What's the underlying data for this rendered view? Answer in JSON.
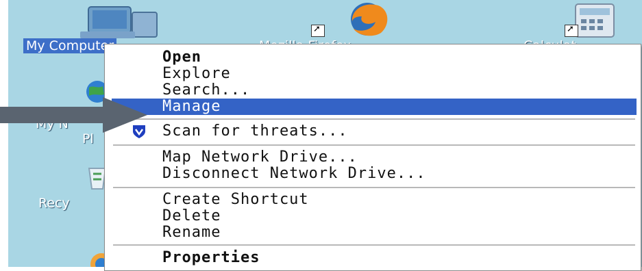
{
  "desktop": {
    "icons": [
      {
        "name": "my-computer",
        "label": "My Computer",
        "selected": true
      },
      {
        "name": "mozilla-firefox",
        "label": "Mozilla Firefox"
      },
      {
        "name": "calculator",
        "label": "Calculat"
      },
      {
        "name": "my-network-places",
        "label": "My N",
        "label2": "Pl"
      },
      {
        "name": "recycle-bin",
        "label": "Recy"
      }
    ]
  },
  "context_menu": {
    "items": [
      {
        "label": "Open",
        "bold": true
      },
      {
        "label": "Explore"
      },
      {
        "label": "Search..."
      },
      {
        "label": "Manage",
        "highlighted": true
      },
      {
        "label": "Scan for threats...",
        "icon": "shield-icon"
      },
      {
        "label": "Map Network Drive..."
      },
      {
        "label": "Disconnect Network Drive..."
      },
      {
        "label": "Create Shortcut"
      },
      {
        "label": "Delete"
      },
      {
        "label": "Rename"
      },
      {
        "label": "Properties"
      }
    ]
  },
  "colors": {
    "desktop_bg": "#a9d6e4",
    "highlight": "#3463c6",
    "pointer_arrow": "#5a6470"
  }
}
